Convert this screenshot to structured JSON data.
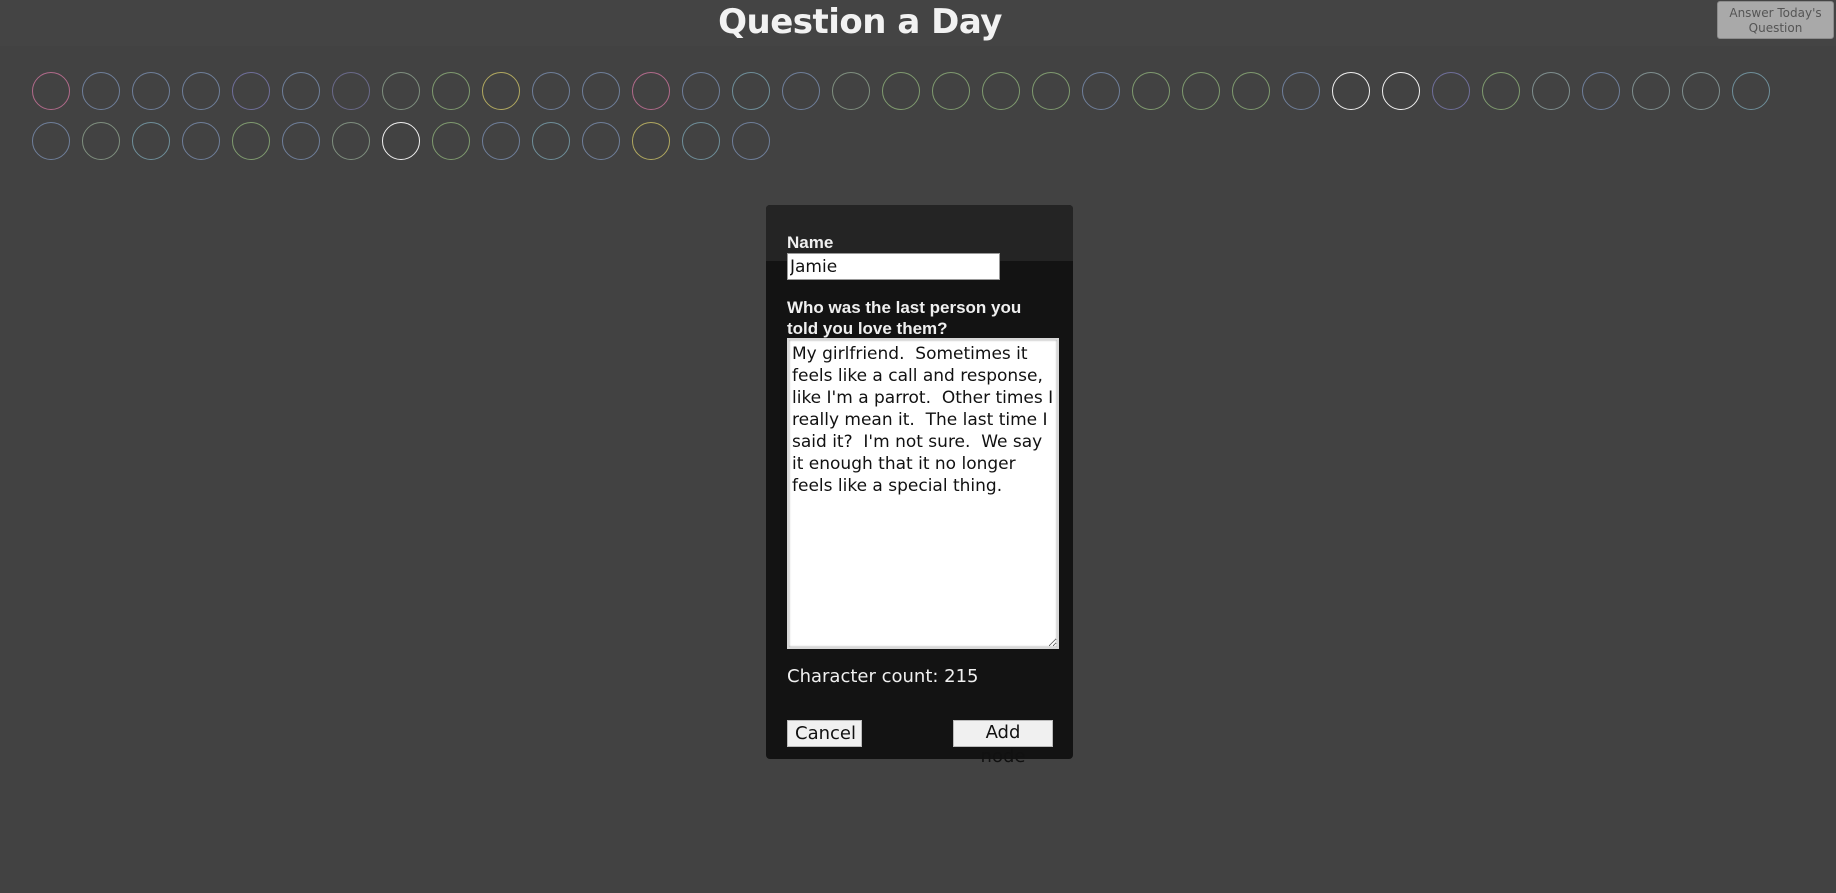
{
  "header": {
    "title": "Question a Day",
    "answer_button": "Answer Today's Question"
  },
  "nodes": [
    {
      "color": "#b06a8a"
    },
    {
      "color": "#6f7f9a"
    },
    {
      "color": "#6f7f9a"
    },
    {
      "color": "#6f7f9a"
    },
    {
      "color": "#6f6f9a"
    },
    {
      "color": "#6f7f9a"
    },
    {
      "color": "#6a6a8a"
    },
    {
      "color": "#7f8f7f"
    },
    {
      "color": "#7f9a6f"
    },
    {
      "color": "#b0a860"
    },
    {
      "color": "#6f7f9a"
    },
    {
      "color": "#6f7f9a"
    },
    {
      "color": "#b06a8a"
    },
    {
      "color": "#6f7f9a"
    },
    {
      "color": "#6f8f9a"
    },
    {
      "color": "#6f7f9a"
    },
    {
      "color": "#7f8f7f"
    },
    {
      "color": "#7f9a6f"
    },
    {
      "color": "#7f9a6f"
    },
    {
      "color": "#7f9a6f"
    },
    {
      "color": "#7f9a6f"
    },
    {
      "color": "#6f7f9a"
    },
    {
      "color": "#7f9a6f"
    },
    {
      "color": "#7f9a6f"
    },
    {
      "color": "#7f9a6f"
    },
    {
      "color": "#6f7f9a"
    },
    {
      "color": "#f0f0f0"
    },
    {
      "color": "#f0f0f0"
    },
    {
      "color": "#6f6f9a"
    },
    {
      "color": "#7f9a6f"
    },
    {
      "color": "#7f8f8f"
    },
    {
      "color": "#6f7f9a"
    },
    {
      "color": "#7f8f8f"
    },
    {
      "color": "#7f8f8f"
    },
    {
      "color": "#6f8f9a"
    },
    {
      "color": "#6f7f9a"
    },
    {
      "color": "#7f8f7f"
    },
    {
      "color": "#6f8f9a"
    },
    {
      "color": "#6f7f9a"
    },
    {
      "color": "#7f9a6f"
    },
    {
      "color": "#6f7f9a"
    },
    {
      "color": "#7f8f7f"
    },
    {
      "color": "#f0f0f0"
    },
    {
      "color": "#7f9a6f"
    },
    {
      "color": "#6f7f9a"
    },
    {
      "color": "#6f8f9a"
    },
    {
      "color": "#6f7f9a"
    },
    {
      "color": "#b0a860"
    },
    {
      "color": "#6f8f9a"
    },
    {
      "color": "#6f7f9a"
    }
  ],
  "dialog": {
    "name_label": "Name",
    "name_value": "Jamie",
    "question_label": "Who was the last person you told you love them?",
    "answer_value": "My girlfriend.  Sometimes it feels like a call and response, like I'm a parrot.  Other times I really mean it.  The last time I said it?  I'm not sure.  We say it enough that it no longer feels like a special thing.",
    "char_count": "Character count: 215",
    "cancel_label": "Cancel",
    "add_label": "Add node"
  }
}
